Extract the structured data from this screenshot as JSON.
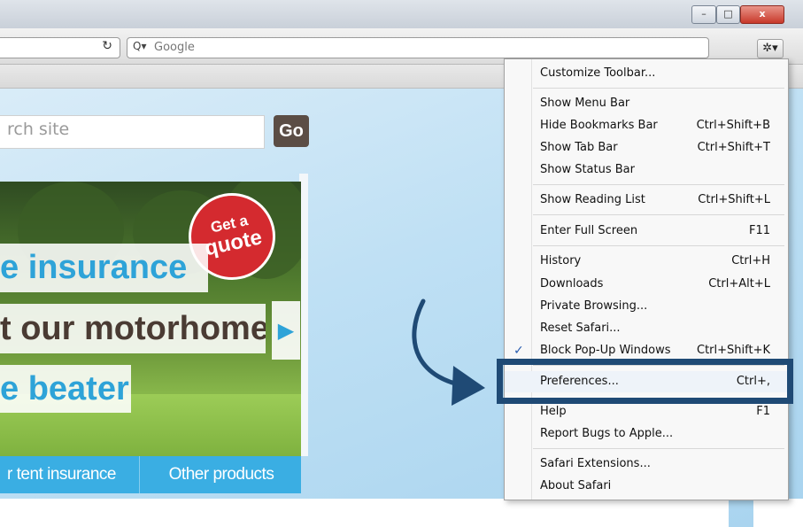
{
  "window": {
    "minimize_label": "–",
    "maximize_label": "□",
    "close_label": "x"
  },
  "toolbar": {
    "reload_icon": "↻",
    "search_placeholder": "Google",
    "search_icon": "Q▾",
    "page_icon": "▯▾",
    "gear_icon": "✲▾"
  },
  "page": {
    "site_search_placeholder": "rch site",
    "go_label": "Go",
    "banner": {
      "badge_line1": "Get a",
      "badge_line2": "quote",
      "headline1": "e insurance",
      "headline2": "t our motorhome",
      "headline3": "e beater",
      "next_arrow": "▶"
    },
    "tabs": [
      "r tent insurance",
      "Other products"
    ]
  },
  "menu": {
    "items": [
      {
        "label": "Customize Toolbar...",
        "shortcut": ""
      },
      {
        "label": "Show Menu Bar",
        "shortcut": ""
      },
      {
        "label": "Hide Bookmarks Bar",
        "shortcut": "Ctrl+Shift+B"
      },
      {
        "label": "Show Tab Bar",
        "shortcut": "Ctrl+Shift+T"
      },
      {
        "label": "Show Status Bar",
        "shortcut": ""
      },
      {
        "label": "Show Reading List",
        "shortcut": "Ctrl+Shift+L"
      },
      {
        "label": "Enter Full Screen",
        "shortcut": "F11"
      },
      {
        "label": "History",
        "shortcut": "Ctrl+H"
      },
      {
        "label": "Downloads",
        "shortcut": "Ctrl+Alt+L"
      },
      {
        "label": "Private Browsing...",
        "shortcut": ""
      },
      {
        "label": "Reset Safari...",
        "shortcut": ""
      },
      {
        "label": "Block Pop-Up Windows",
        "shortcut": "Ctrl+Shift+K",
        "checked": true
      },
      {
        "label": "Preferences...",
        "shortcut": "Ctrl+,"
      },
      {
        "label": "Help",
        "shortcut": "F1"
      },
      {
        "label": "Report Bugs to Apple...",
        "shortcut": ""
      },
      {
        "label": "Safari Extensions...",
        "shortcut": ""
      },
      {
        "label": "About Safari",
        "shortcut": ""
      }
    ],
    "check_mark": "✓"
  },
  "colors": {
    "callout": "#1f4a75",
    "accent_blue": "#2ea3d8",
    "badge_red": "#d42a2f"
  }
}
